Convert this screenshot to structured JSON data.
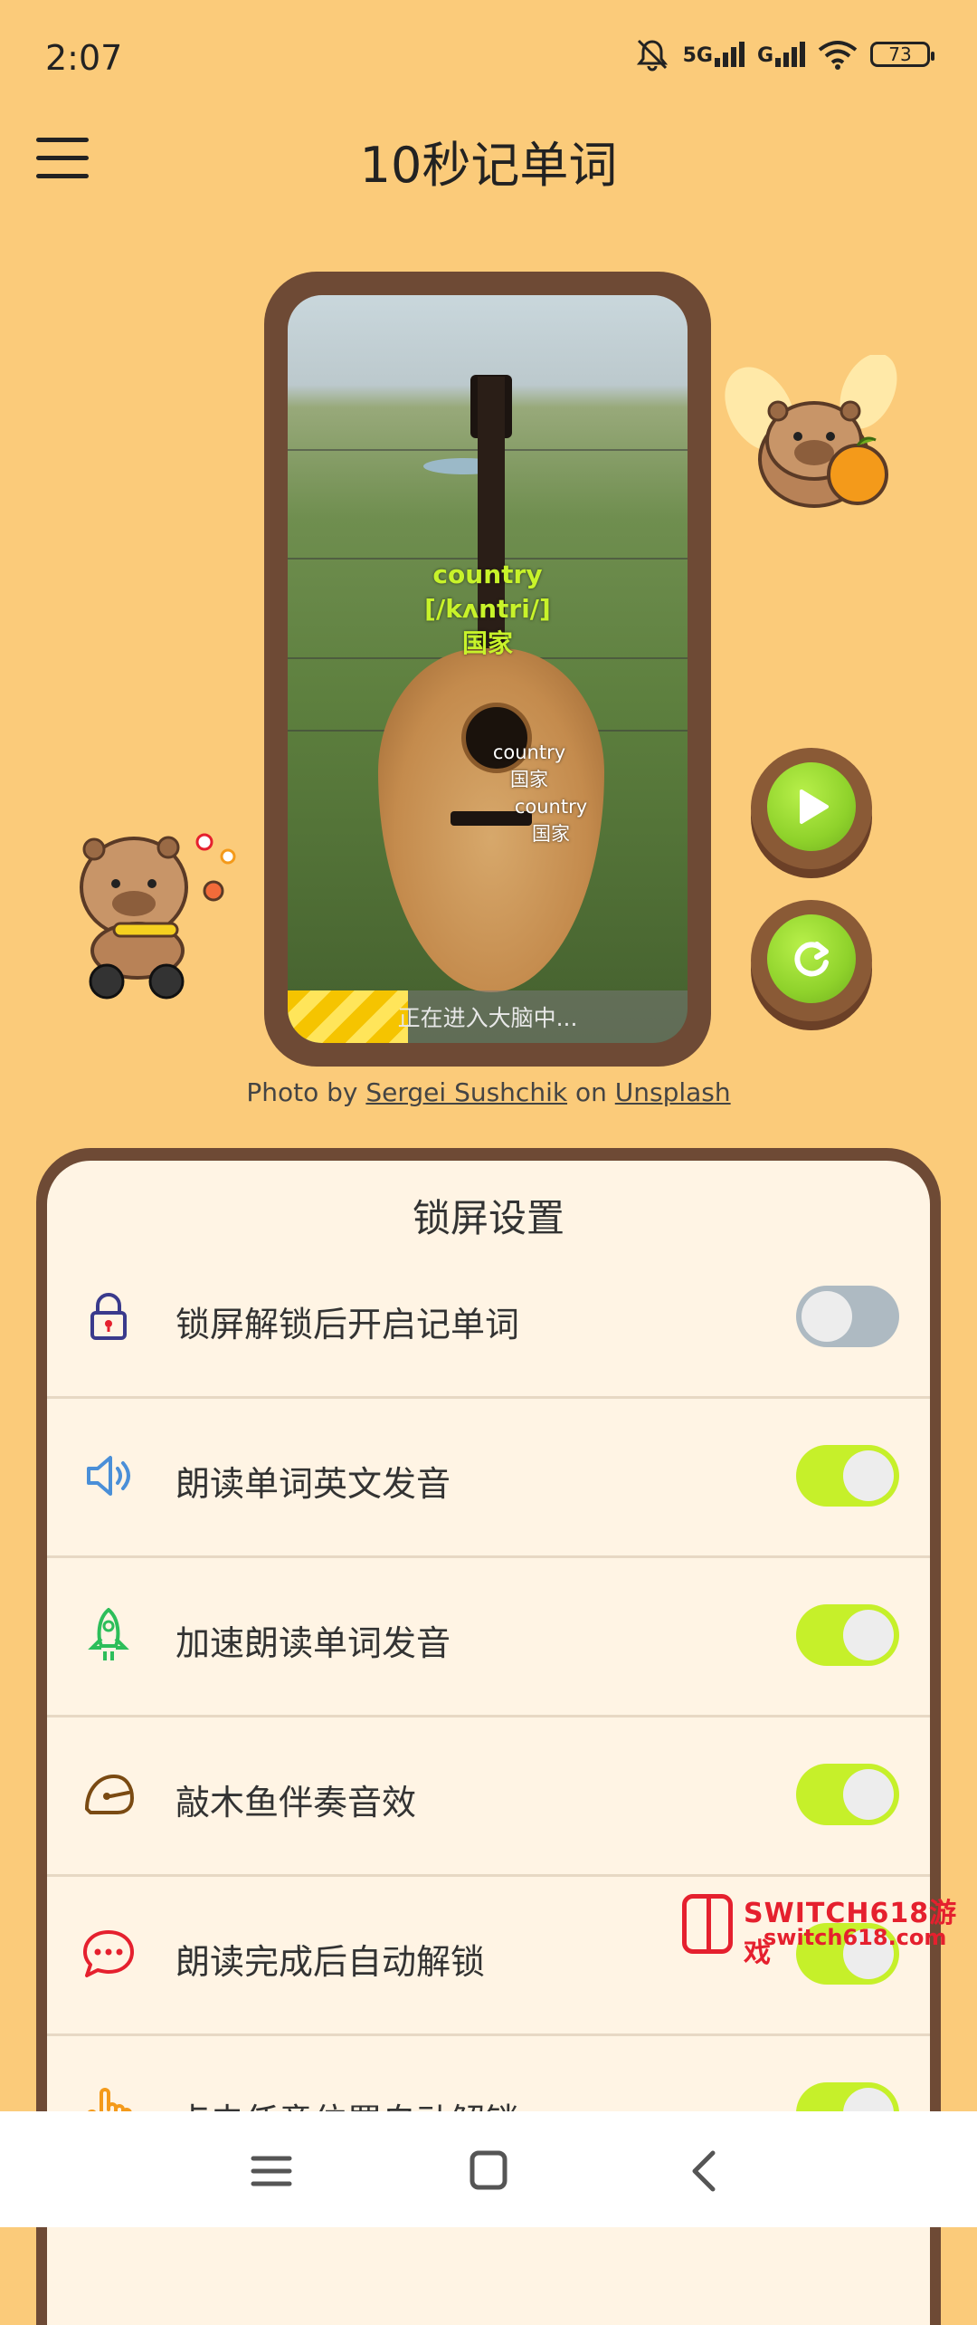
{
  "status_bar": {
    "time": "2:07",
    "signal1": "5G",
    "signal2": "G",
    "battery": "73"
  },
  "header": {
    "title": "10秒记单词",
    "menu_icon": "hamburger-menu-icon"
  },
  "preview": {
    "word": "country",
    "phonetic": "[/kʌntri/]",
    "meaning": "国家",
    "float_word_1": "country",
    "float_meaning_1": "国家",
    "float_word_2": "country",
    "float_meaning_2": "国家",
    "progress_text": "正在进入大脑中...",
    "progress_fraction": 0.3,
    "word_color": "#C8F32A"
  },
  "credit": {
    "prefix": "Photo by",
    "author": "Sergei Sushchik",
    "middle": "on",
    "site": "Unsplash"
  },
  "side_buttons": {
    "play_icon": "play-icon",
    "refresh_icon": "refresh-icon"
  },
  "settings": {
    "title": "锁屏设置",
    "items": [
      {
        "label": "锁屏解锁后开启记单词",
        "icon": "lock-icon",
        "enabled": false
      },
      {
        "label": "朗读单词英文发音",
        "icon": "speaker-icon",
        "enabled": true
      },
      {
        "label": "加速朗读单词发音",
        "icon": "rocket-icon",
        "enabled": true
      },
      {
        "label": "敲木鱼伴奏音效",
        "icon": "wooden-fish-icon",
        "enabled": true
      },
      {
        "label": "朗读完成后自动解锁",
        "icon": "chat-bubble-icon",
        "enabled": true
      },
      {
        "label": "点击任意位置自动解锁",
        "icon": "hand-tap-icon",
        "enabled": true
      }
    ]
  },
  "watermark": {
    "title": "SWITCH618游戏",
    "sub": "switch618.com"
  },
  "colors": {
    "background": "#FBCB7A",
    "frame": "#6E4A35",
    "toggle_on": "#C6F02A",
    "toggle_off": "#AEBAC2",
    "card": "#FFF4E4"
  },
  "nav": {
    "menu_icon": "recent-apps-icon",
    "home_icon": "home-icon",
    "back_icon": "back-icon"
  }
}
